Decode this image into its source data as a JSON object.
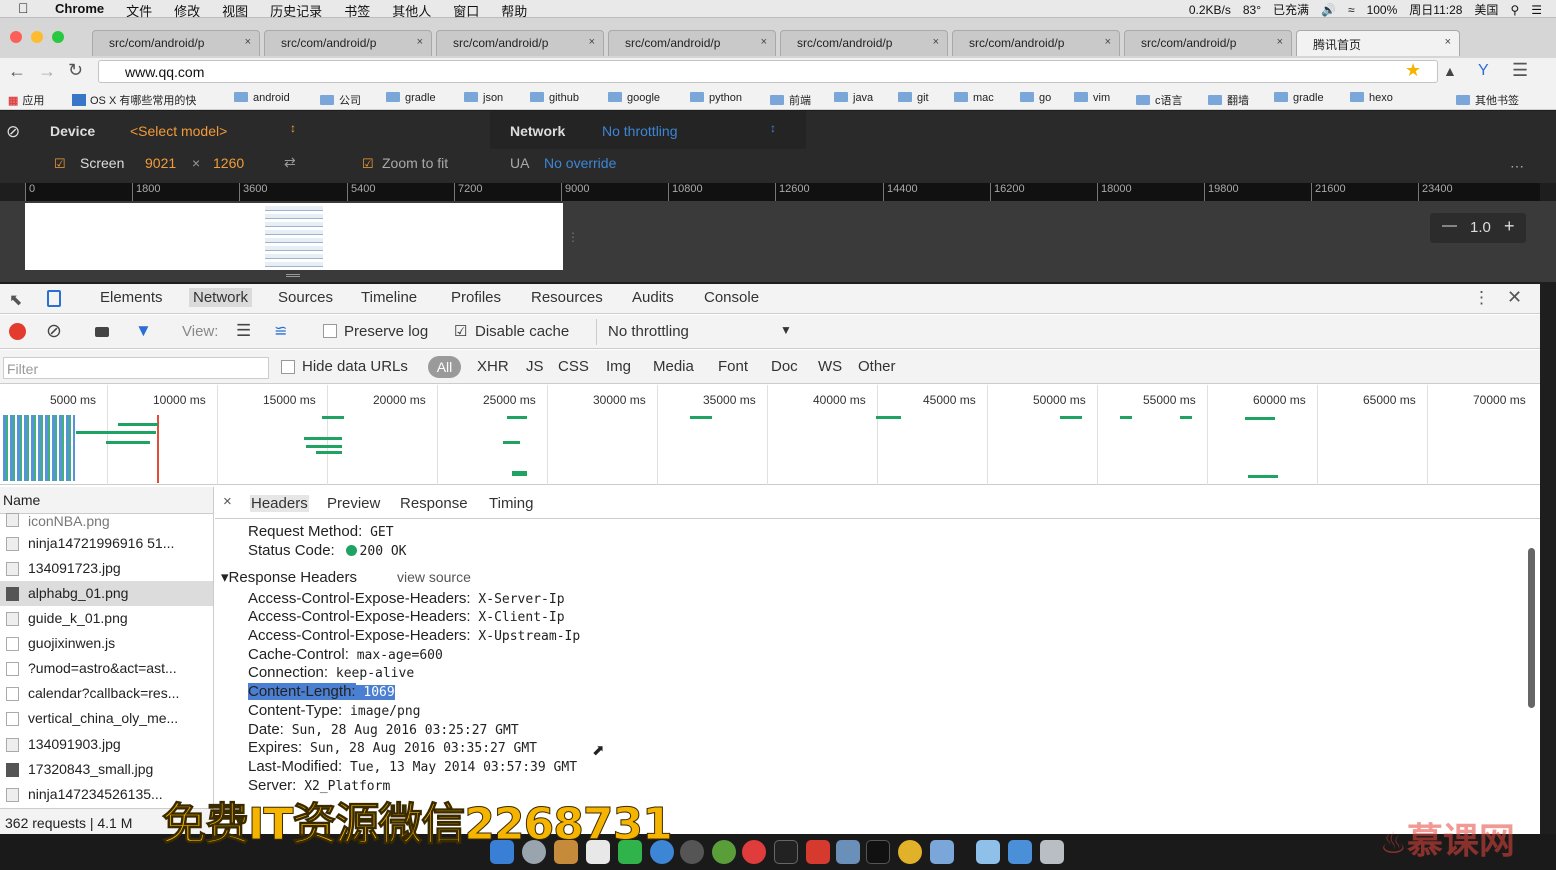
{
  "menubar": {
    "app": "Chrome",
    "items": [
      "文件",
      "修改",
      "视图",
      "历史记录",
      "书签",
      "其他人",
      "窗口",
      "帮助"
    ],
    "battery": "100%",
    "charging": "已充满",
    "clock": "周日11:28",
    "input_method": "美国",
    "net_speed": "0.2KB/s",
    "temperature": "83°"
  },
  "browser": {
    "tabs": [
      {
        "label": "src/com/android/p"
      },
      {
        "label": "src/com/android/p"
      },
      {
        "label": "src/com/android/p"
      },
      {
        "label": "src/com/android/p"
      },
      {
        "label": "src/com/android/p"
      },
      {
        "label": "src/com/android/p"
      },
      {
        "label": "src/com/android/p"
      },
      {
        "label": "腾讯首页"
      }
    ],
    "url": "www.qq.com",
    "bookmarks": [
      "应用",
      "OS X 有哪些常用的快",
      "android",
      "公司",
      "gradle",
      "json",
      "github",
      "google",
      "python",
      "前端",
      "java",
      "git",
      "mac",
      "go",
      "vim",
      "c语言",
      "翻墙",
      "gradle",
      "hexo",
      "其他书签"
    ]
  },
  "device_mode": {
    "device_label": "Device",
    "model_placeholder": "<Select model>",
    "network_label": "Network",
    "network_value": "No throttling",
    "screen_label": "Screen",
    "screen_width": "9021",
    "times": "×",
    "screen_height": "1260",
    "zoom_to_fit": "Zoom to fit",
    "ua_label": "UA",
    "ua_value": "No override",
    "ruler": [
      "0",
      "1800",
      "3600",
      "5400",
      "7200",
      "9000",
      "10800",
      "12600",
      "14400",
      "16200",
      "18000",
      "19800",
      "21600",
      "23400"
    ],
    "zoom_value": "1.0",
    "zoom_minus": "—",
    "zoom_plus": "+"
  },
  "devtools": {
    "tabs": [
      "Elements",
      "Network",
      "Sources",
      "Timeline",
      "Profiles",
      "Resources",
      "Audits",
      "Console"
    ],
    "active_tab": "Network",
    "toolbar": {
      "view_label": "View:",
      "preserve_log": "Preserve log",
      "disable_cache": "Disable cache",
      "throttling": "No throttling"
    },
    "filter": {
      "placeholder": "Filter",
      "hide_data_urls": "Hide data URLs",
      "types": [
        "All",
        "XHR",
        "JS",
        "CSS",
        "Img",
        "Media",
        "Font",
        "Doc",
        "WS",
        "Other"
      ]
    },
    "overview_labels": [
      "5000 ms",
      "10000 ms",
      "15000 ms",
      "20000 ms",
      "25000 ms",
      "30000 ms",
      "35000 ms",
      "40000 ms",
      "45000 ms",
      "50000 ms",
      "55000 ms",
      "60000 ms",
      "65000 ms",
      "70000 ms"
    ],
    "requests": {
      "header": "Name",
      "rows": [
        {
          "name": "iconNBA.png",
          "selected": false
        },
        {
          "name": "ninja14721996916 51...",
          "selected": false
        },
        {
          "name": "134091723.jpg",
          "selected": false
        },
        {
          "name": "alphabg_01.png",
          "selected": true
        },
        {
          "name": "guide_k_01.png",
          "selected": false
        },
        {
          "name": "guojixinwen.js",
          "selected": false
        },
        {
          "name": "?umod=astro&act=ast...",
          "selected": false
        },
        {
          "name": "calendar?callback=res...",
          "selected": false
        },
        {
          "name": "vertical_china_oly_me...",
          "selected": false
        },
        {
          "name": "134091903.jpg",
          "selected": false
        },
        {
          "name": "17320843_small.jpg",
          "selected": false
        },
        {
          "name": "ninja147234526135...",
          "selected": false
        }
      ],
      "footer": "362 requests | 4.1 M"
    },
    "detail": {
      "tabs": [
        "Headers",
        "Preview",
        "Response",
        "Timing"
      ],
      "active_tab": "Headers",
      "request_method_label": "Request Method:",
      "request_method": "GET",
      "status_code_label": "Status Code:",
      "status_code": "200 OK",
      "response_headers_title": "Response Headers",
      "view_source": "view source",
      "headers": [
        {
          "key": "Access-Control-Expose-Headers:",
          "value": "X-Server-Ip"
        },
        {
          "key": "Access-Control-Expose-Headers:",
          "value": "X-Client-Ip"
        },
        {
          "key": "Access-Control-Expose-Headers:",
          "value": "X-Upstream-Ip"
        },
        {
          "key": "Cache-Control:",
          "value": "max-age=600"
        },
        {
          "key": "Connection:",
          "value": "keep-alive"
        },
        {
          "key": "Content-Length:",
          "value": "1069"
        },
        {
          "key": "Content-Type:",
          "value": "image/png"
        },
        {
          "key": "Date:",
          "value": "Sun, 28 Aug 2016 03:25:27 GMT"
        },
        {
          "key": "Expires:",
          "value": "Sun, 28 Aug 2016 03:35:27 GMT"
        },
        {
          "key": "Last-Modified:",
          "value": "Tue, 13 May 2014 03:57:39 GMT"
        },
        {
          "key": "Server:",
          "value": "X2_Platform"
        }
      ],
      "status_color": "#1ea362"
    }
  },
  "overlay": {
    "watermark": "免费IT资源微信2268731",
    "logo": "慕课网"
  },
  "colors": {
    "accent_blue": "#3d86d6",
    "orange": "#f29b38",
    "record_red": "#e33b2e",
    "waterfall_green": "#1ea362"
  }
}
